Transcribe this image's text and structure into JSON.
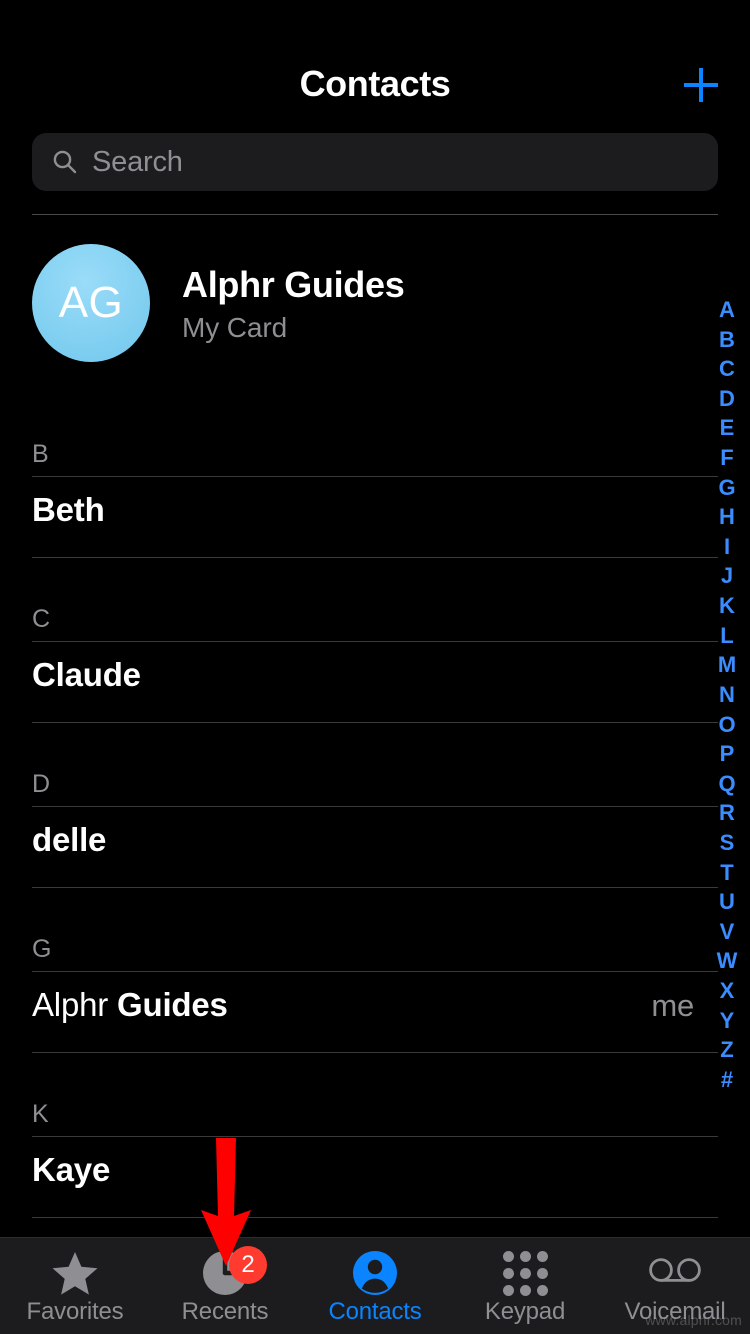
{
  "app": {
    "title": "Contacts",
    "background_color": "#000000",
    "accent_color": "#0a84ff"
  },
  "navbar": {
    "title": "Contacts",
    "add_button_icon": "plus-icon",
    "add_button_color": "#0a84ff"
  },
  "search": {
    "placeholder": "Search",
    "value": "",
    "icon": "search-icon",
    "field_color": "#1c1c1e"
  },
  "my_card": {
    "initials": "AG",
    "name": "Alphr Guides",
    "subtitle": "My Card",
    "avatar_color": "#7ccdf0"
  },
  "contacts": {
    "sections": [
      {
        "letter": "B",
        "rows": [
          {
            "given": "",
            "family": "Beth",
            "display": "Beth",
            "badge": ""
          }
        ]
      },
      {
        "letter": "C",
        "rows": [
          {
            "given": "",
            "family": "Claude",
            "display": "Claude",
            "badge": ""
          }
        ]
      },
      {
        "letter": "D",
        "rows": [
          {
            "given": "",
            "family": "delle",
            "display": "delle",
            "badge": ""
          }
        ]
      },
      {
        "letter": "G",
        "rows": [
          {
            "given": "Alphr ",
            "family": "Guides",
            "display": "Alphr Guides",
            "badge": "me"
          }
        ]
      },
      {
        "letter": "K",
        "rows": [
          {
            "given": "",
            "family": "Kaye",
            "display": "Kaye",
            "badge": ""
          }
        ]
      }
    ]
  },
  "index_bar": {
    "color": "#3a8cff",
    "letters": [
      "A",
      "B",
      "C",
      "D",
      "E",
      "F",
      "G",
      "H",
      "I",
      "J",
      "K",
      "L",
      "M",
      "N",
      "O",
      "P",
      "Q",
      "R",
      "S",
      "T",
      "U",
      "V",
      "W",
      "X",
      "Y",
      "Z",
      "#"
    ]
  },
  "tabbar": {
    "background_color": "#1c1c1e",
    "items": [
      {
        "label": "Favorites",
        "icon": "star-icon",
        "active": false,
        "badge": ""
      },
      {
        "label": "Recents",
        "icon": "clock-icon",
        "active": false,
        "badge": "2"
      },
      {
        "label": "Contacts",
        "icon": "person-icon",
        "active": true,
        "badge": ""
      },
      {
        "label": "Keypad",
        "icon": "keypad-icon",
        "active": false,
        "badge": ""
      },
      {
        "label": "Voicemail",
        "icon": "voicemail-icon",
        "active": false,
        "badge": ""
      }
    ]
  },
  "annotation": {
    "arrow_icon": "down-arrow-annotation",
    "arrow_color": "#ff0000",
    "points_to": "Recents"
  },
  "watermark": {
    "text": "www.alphr.com"
  }
}
